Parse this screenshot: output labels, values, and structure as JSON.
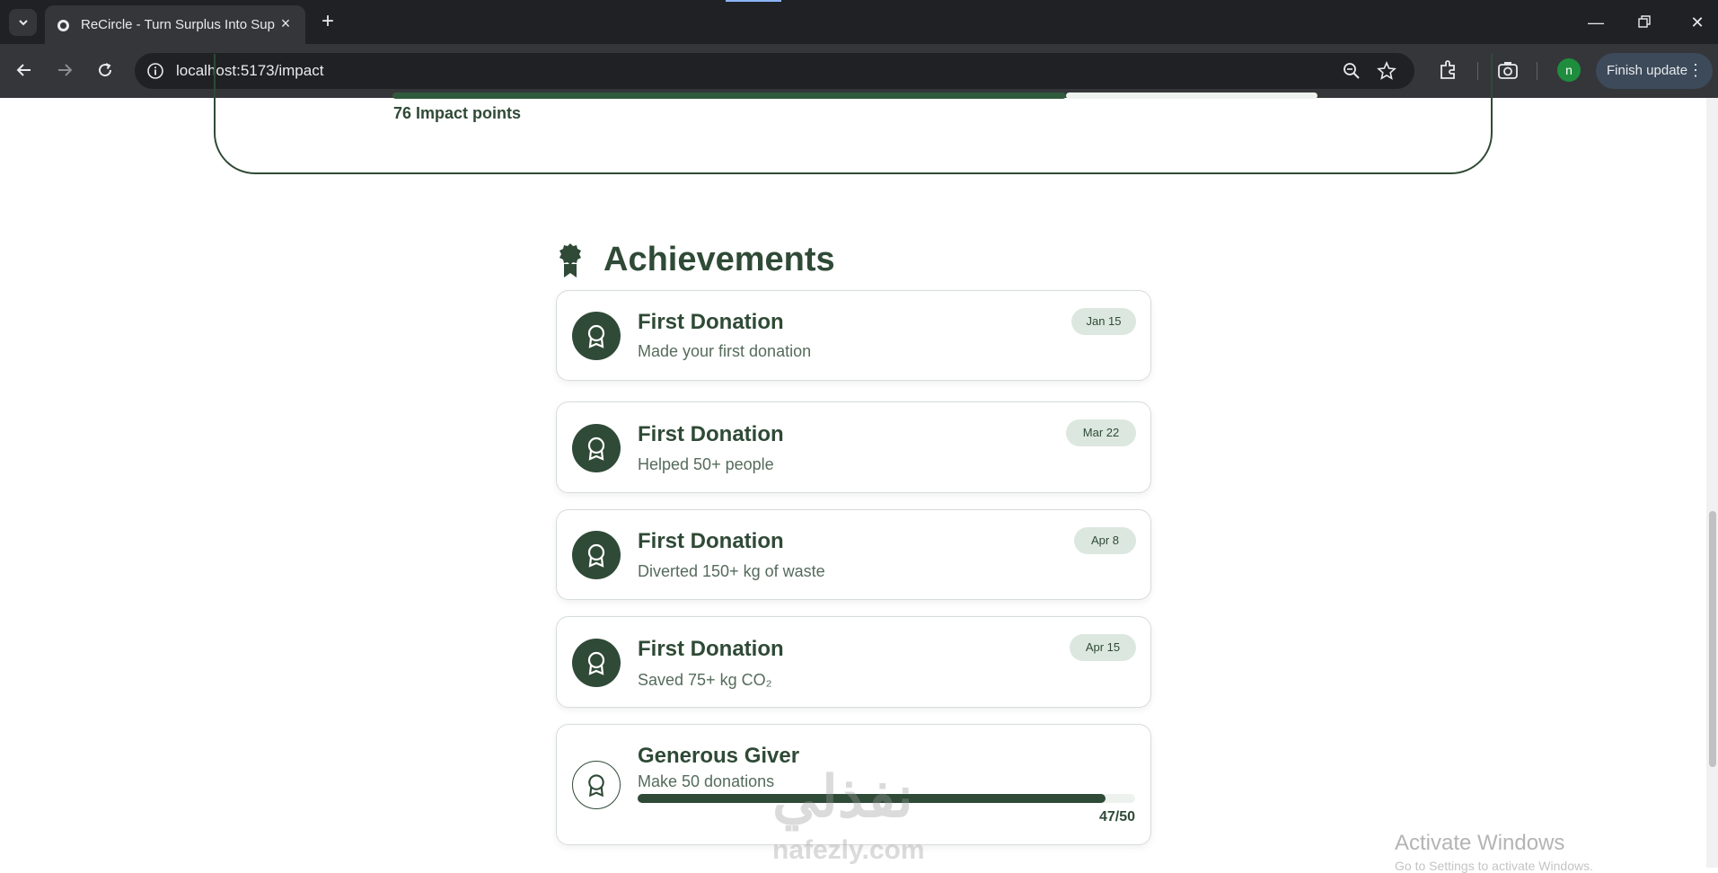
{
  "browser": {
    "tab_title": "ReCircle - Turn Surplus Into Sup",
    "url": "localhost:5173/impact",
    "profile_initial": "n",
    "finish_update_label": "Finish update"
  },
  "impact": {
    "points_label": "76 Impact points"
  },
  "achievements": {
    "heading": "Achievements",
    "items": [
      {
        "title": "First Donation",
        "description": "Made your first donation",
        "date": "Jan 15"
      },
      {
        "title": "First Donation",
        "description": "Helped 50+ people",
        "date": "Mar 22"
      },
      {
        "title": "First Donation",
        "description": "Diverted 150+ kg of waste",
        "date": "Apr 8"
      },
      {
        "title": "First Donation",
        "description": "Saved 75+ kg CO₂",
        "date": "Apr 15"
      }
    ],
    "in_progress": {
      "title": "Generous Giver",
      "description": "Make 50 donations",
      "progress_label": "47/50",
      "progress": 0.94
    }
  },
  "os_overlay": {
    "activate_title": "Activate Windows",
    "activate_sub": "Go to Settings to activate Windows."
  },
  "watermark": {
    "arabic": "نفذلي",
    "latin": "nafezly.com"
  },
  "colors": {
    "brand_green": "#2f4a36",
    "badge_bg": "#dce8df"
  }
}
